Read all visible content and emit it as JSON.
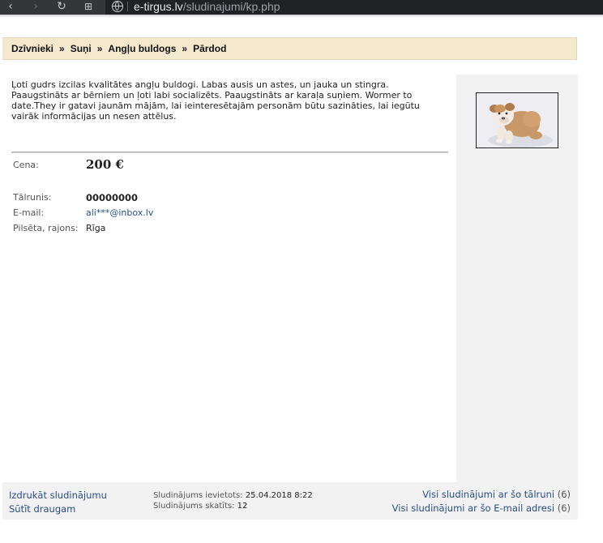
{
  "browser": {
    "url_domain": "e-tirgus.lv",
    "url_path": "/sludinajumi/kp.php",
    "icons": [
      "back-icon",
      "forward-icon",
      "reload-icon",
      "grid-icon",
      "globe-icon"
    ]
  },
  "breadcrumb": {
    "items": [
      "Dzīvnieki",
      "Suņi",
      "Angļu buldogs",
      "Pārdod"
    ],
    "separator": "»"
  },
  "listing": {
    "description": "Ļoti gudrs izcilas kvalitātes angļu buldogi. Labas ausis un astes, un jauka un stingra. Paaugstināts ar bērniem un ļoti labi socializēts. Paaugstināts ar karaļa suņiem. Wormer to date.They ir gatavi jaunām mājām, lai ieinteresētajām personām būtu sazināties, lai iegūtu vairāk informācijas un nesen attēlus.",
    "price_label": "Cena:",
    "price_value": "200 €",
    "phone_label": "Tālrunis:",
    "phone_value": "00000000",
    "email_label": "E-mail:",
    "email_value": "ali***@inbox.lv",
    "city_label": "Pilsēta, rajons:",
    "city_value": "Rīga"
  },
  "footer": {
    "print_link": "Izdrukāt sludinājumu",
    "send_link": "Sūtīt draugam",
    "posted_label": "Sludinājums ievietots:",
    "posted_value": "25.04.2018 8:22",
    "views_label": "Sludinājums skatīts:",
    "views_value": "12",
    "all_by_phone_link": "Visi sludinājumi ar šo tālruni",
    "all_by_phone_count": "(6)",
    "all_by_email_link": "Visi sludinājumi ar šo E-mail adresi",
    "all_by_email_count": "(6)"
  },
  "colors": {
    "breadcrumb_bg": "#f4e9cf",
    "link": "#2a4e8a",
    "side_bg": "#f2f2f2",
    "browser_bar": "#35363a"
  }
}
